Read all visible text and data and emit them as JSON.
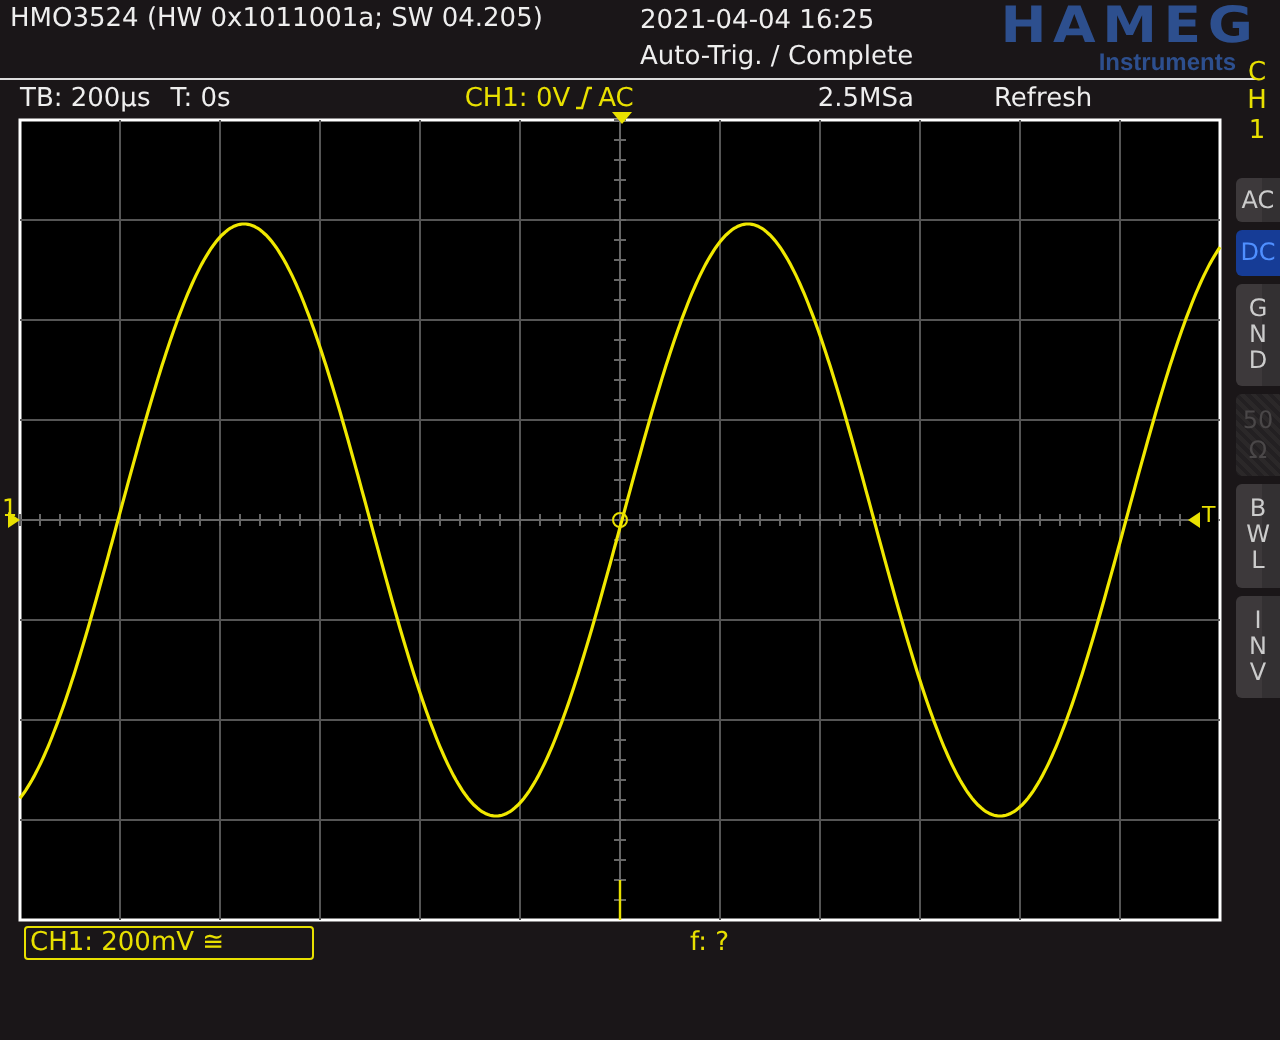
{
  "header": {
    "title": "HMO3524 (HW 0x1011001a; SW 04.205)",
    "datetime": "2021-04-04 16:25",
    "status": "Auto-Trig. / Complete",
    "logo": "HAMEG",
    "logo_sub": "Instruments"
  },
  "info_bar": {
    "timebase": "TB: 200µs",
    "trigger_time": "T: 0s",
    "channel": "CH1: 0V",
    "rising_edge": true,
    "coupling": "AC",
    "sample_rate": "2.5MSa",
    "mode": "Refresh"
  },
  "markers": {
    "channel": "1",
    "trigger": "T"
  },
  "side_menu": {
    "title": "CH1",
    "items": [
      {
        "kind": "horizontal",
        "label": "AC",
        "selected": false,
        "disabled": false
      },
      {
        "kind": "horizontal",
        "label": "DC",
        "selected": true,
        "disabled": false
      },
      {
        "kind": "vertical",
        "label": "GND",
        "selected": false,
        "disabled": false
      },
      {
        "kind": "stacked",
        "label": "50",
        "sub": "Ω",
        "selected": false,
        "disabled": true
      },
      {
        "kind": "vertical",
        "label": "BWL",
        "selected": false,
        "disabled": false
      },
      {
        "kind": "vertical",
        "label": "INV",
        "selected": false,
        "disabled": false
      }
    ]
  },
  "footer": {
    "channel_scale": "CH1: 200mV ≅",
    "frequency": "f: ?"
  }
}
